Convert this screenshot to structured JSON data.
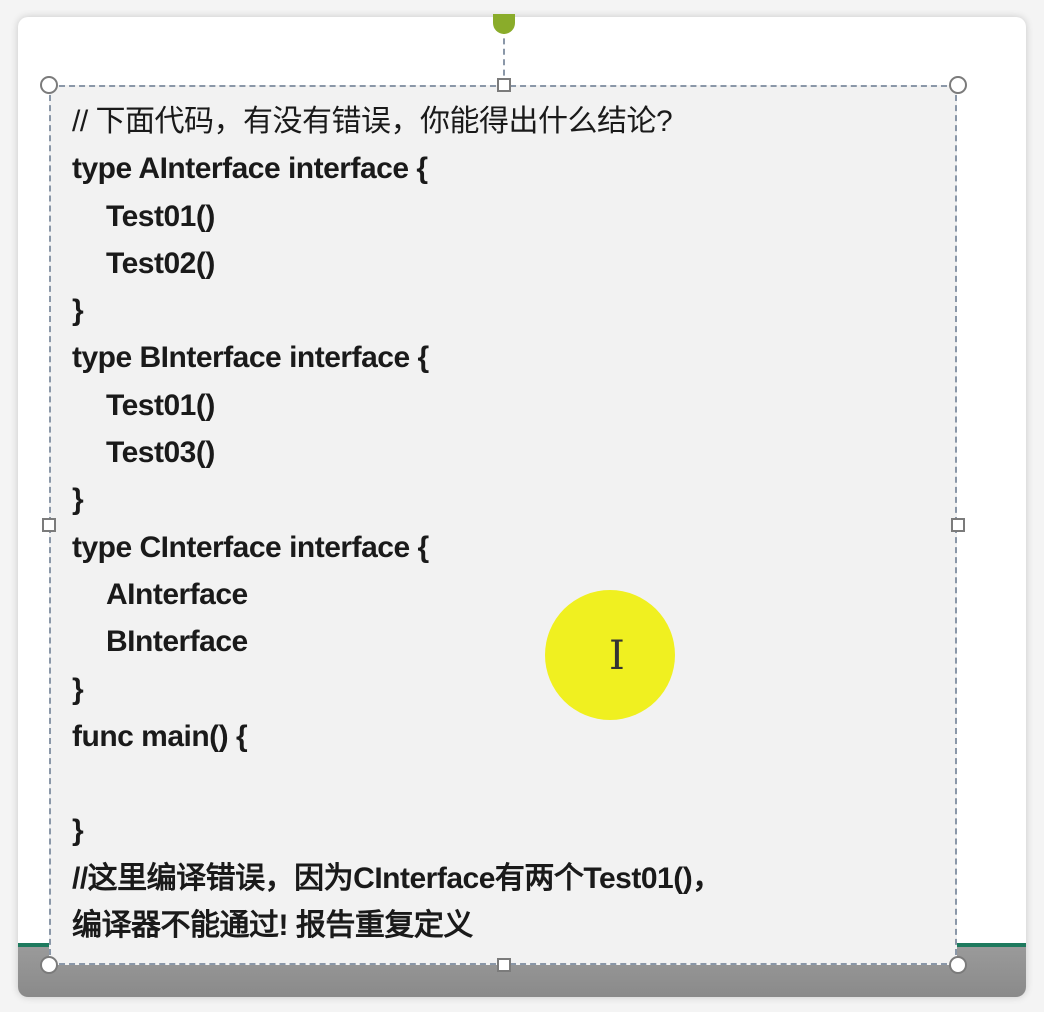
{
  "code_lines": [
    "// 下面代码，有没有错误，你能得出什么结论?",
    "type AInterface interface {",
    "Test01()",
    "Test02()",
    "}",
    "type BInterface interface {",
    "Test01()",
    "Test03()",
    "}",
    "type CInterface interface {",
    "AInterface",
    "BInterface",
    "}",
    "func main() {",
    "",
    "}",
    "//这里编译错误，因为CInterface有两个Test01()，",
    "编译器不能通过! 报告重复定义"
  ],
  "cursor_glyph": "I"
}
